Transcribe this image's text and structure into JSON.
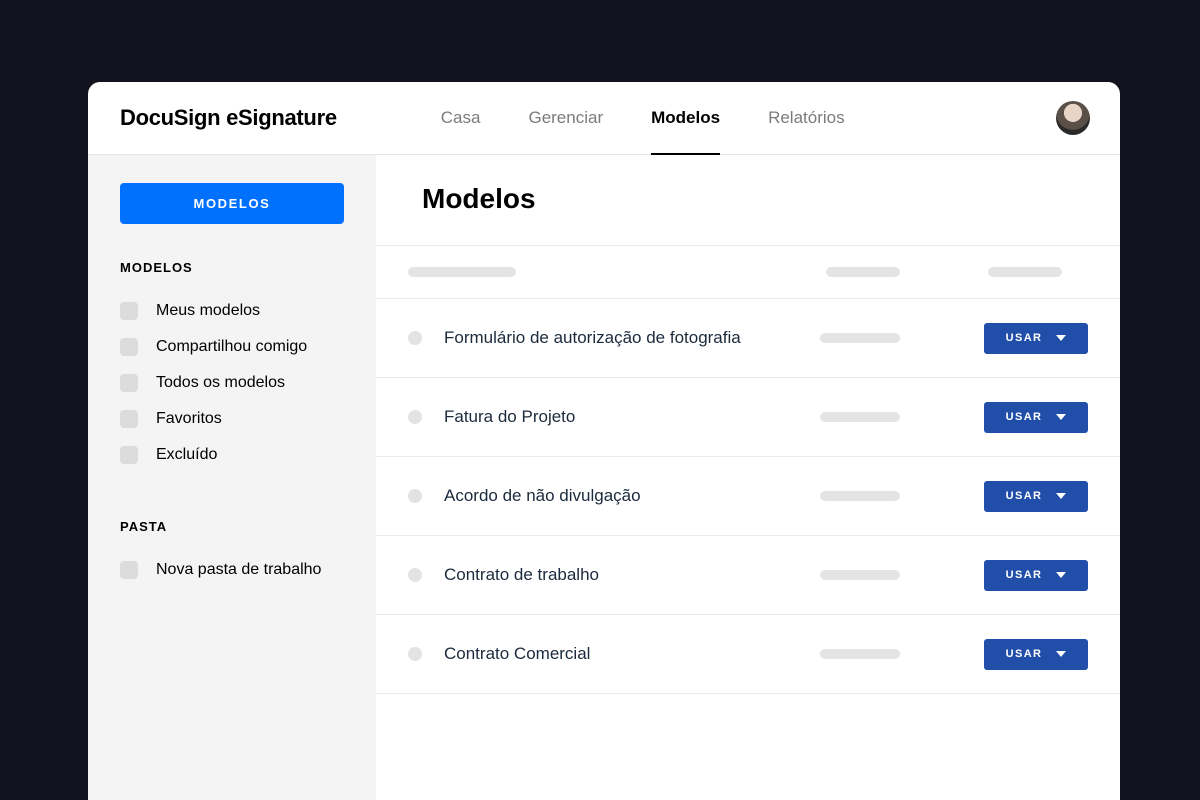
{
  "logo": "DocuSign eSignature",
  "nav": {
    "items": [
      "Casa",
      "Gerenciar",
      "Modelos",
      "Relatórios"
    ],
    "activeIndex": 2
  },
  "sidebar": {
    "primaryButton": "MODELOS",
    "sections": [
      {
        "label": "MODELOS",
        "items": [
          "Meus modelos",
          "Compartilhou comigo",
          "Todos os modelos",
          "Favoritos",
          "Excluído"
        ]
      },
      {
        "label": "PASTA",
        "items": [
          "Nova pasta de trabalho"
        ]
      }
    ]
  },
  "main": {
    "title": "Modelos",
    "actionLabel": "USAR",
    "rows": [
      {
        "name": "Formulário de autorização de fotografia"
      },
      {
        "name": "Fatura do Projeto"
      },
      {
        "name": "Acordo de não divulgação"
      },
      {
        "name": "Contrato de trabalho"
      },
      {
        "name": "Contrato Comercial"
      }
    ]
  }
}
